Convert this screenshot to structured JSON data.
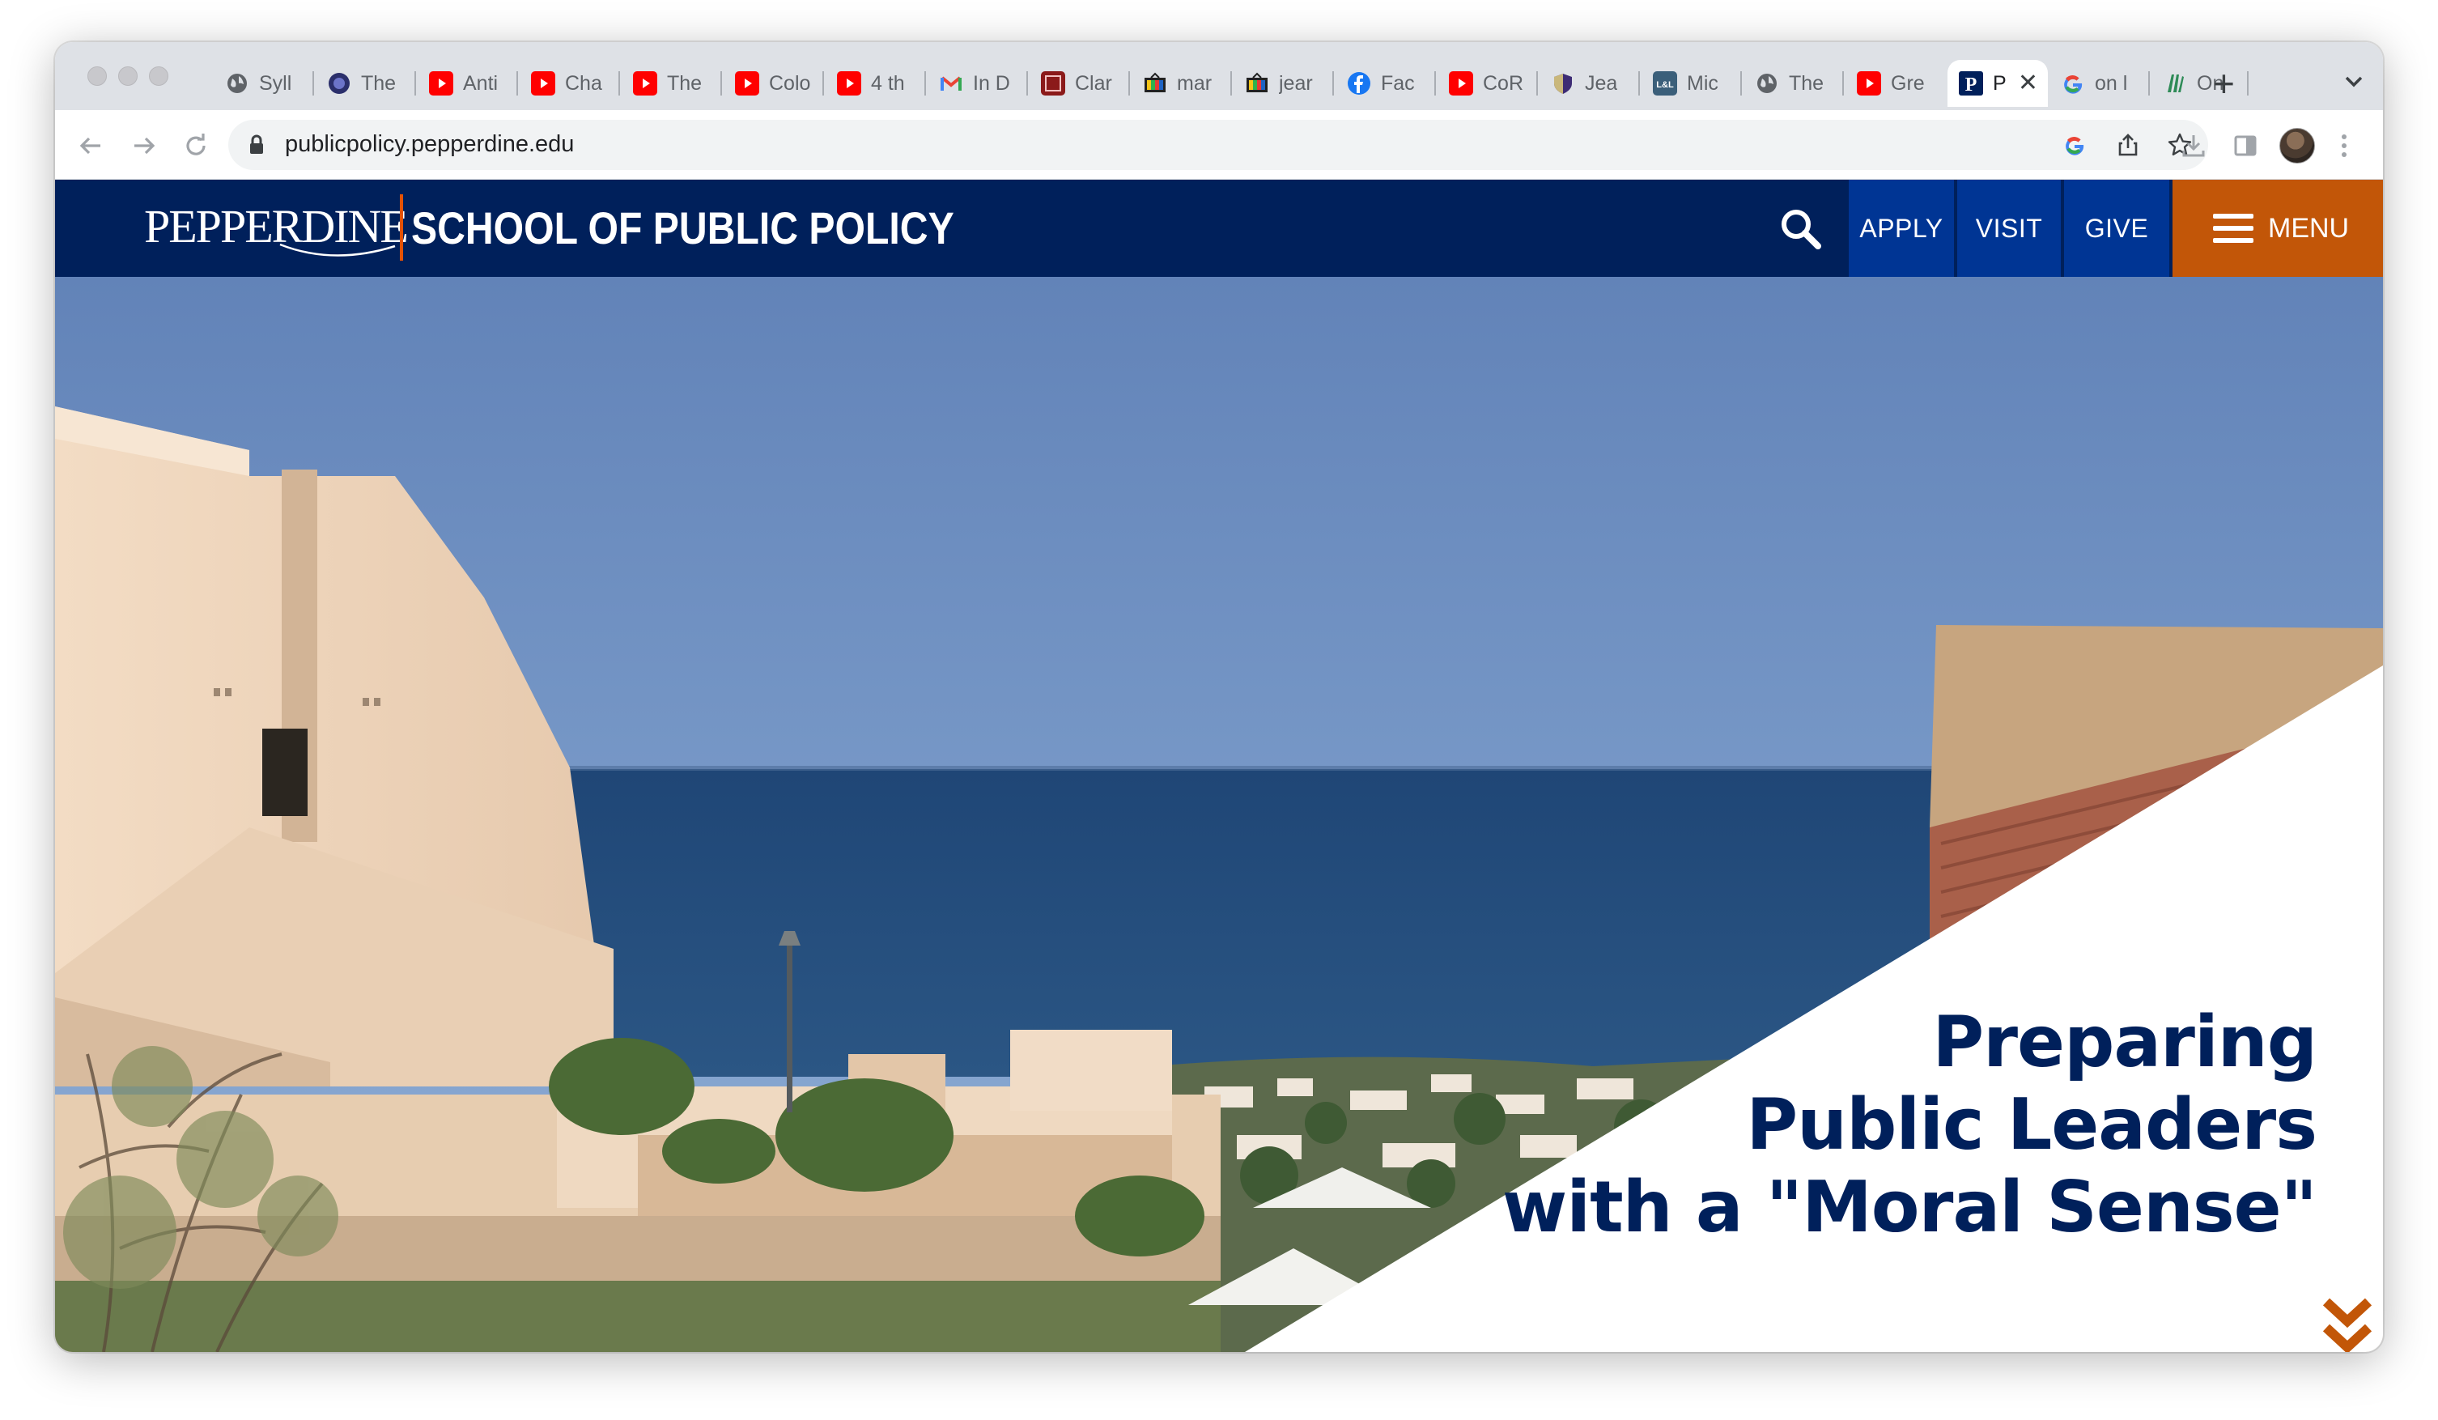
{
  "browser": {
    "tabs": [
      {
        "label": "Syll",
        "icon": "globe-icon"
      },
      {
        "label": "The",
        "icon": "planet-icon"
      },
      {
        "label": "Anti",
        "icon": "youtube-icon"
      },
      {
        "label": "Cha",
        "icon": "youtube-icon"
      },
      {
        "label": "The",
        "icon": "youtube-icon"
      },
      {
        "label": "Colo",
        "icon": "youtube-icon"
      },
      {
        "label": "4 th",
        "icon": "youtube-icon"
      },
      {
        "label": "In D",
        "icon": "gmail-icon"
      },
      {
        "label": "Clar",
        "icon": "c3-icon"
      },
      {
        "label": "mar",
        "icon": "tv-icon"
      },
      {
        "label": "jear",
        "icon": "tv-icon"
      },
      {
        "label": "Fac",
        "icon": "facebook-icon"
      },
      {
        "label": "CoR",
        "icon": "youtube-icon"
      },
      {
        "label": "Jea",
        "icon": "shield-icon"
      },
      {
        "label": "Mic",
        "icon": "ll-icon"
      },
      {
        "label": "The",
        "icon": "globe-icon"
      },
      {
        "label": "Gre",
        "icon": "youtube-icon"
      },
      {
        "label": "P",
        "icon": "pepperdine-p-icon",
        "active": true
      },
      {
        "label": "on l",
        "icon": "google-icon"
      },
      {
        "label": "On",
        "icon": "library-icon"
      }
    ],
    "url": "publicpolicy.pepperdine.edu"
  },
  "site": {
    "logo_wordmark": "PEPPERDINE",
    "logo_school": "SCHOOL OF PUBLIC POLICY",
    "nav": {
      "apply": "APPLY",
      "visit": "VISIT",
      "give": "GIVE",
      "menu": "MENU"
    },
    "colors": {
      "navy": "#00205b",
      "blue": "#003594",
      "orange": "#c25608"
    }
  },
  "hero": {
    "headline_line1": "Preparing",
    "headline_line2": "Public Leaders",
    "headline_line3": "with a \"Moral Sense\""
  }
}
